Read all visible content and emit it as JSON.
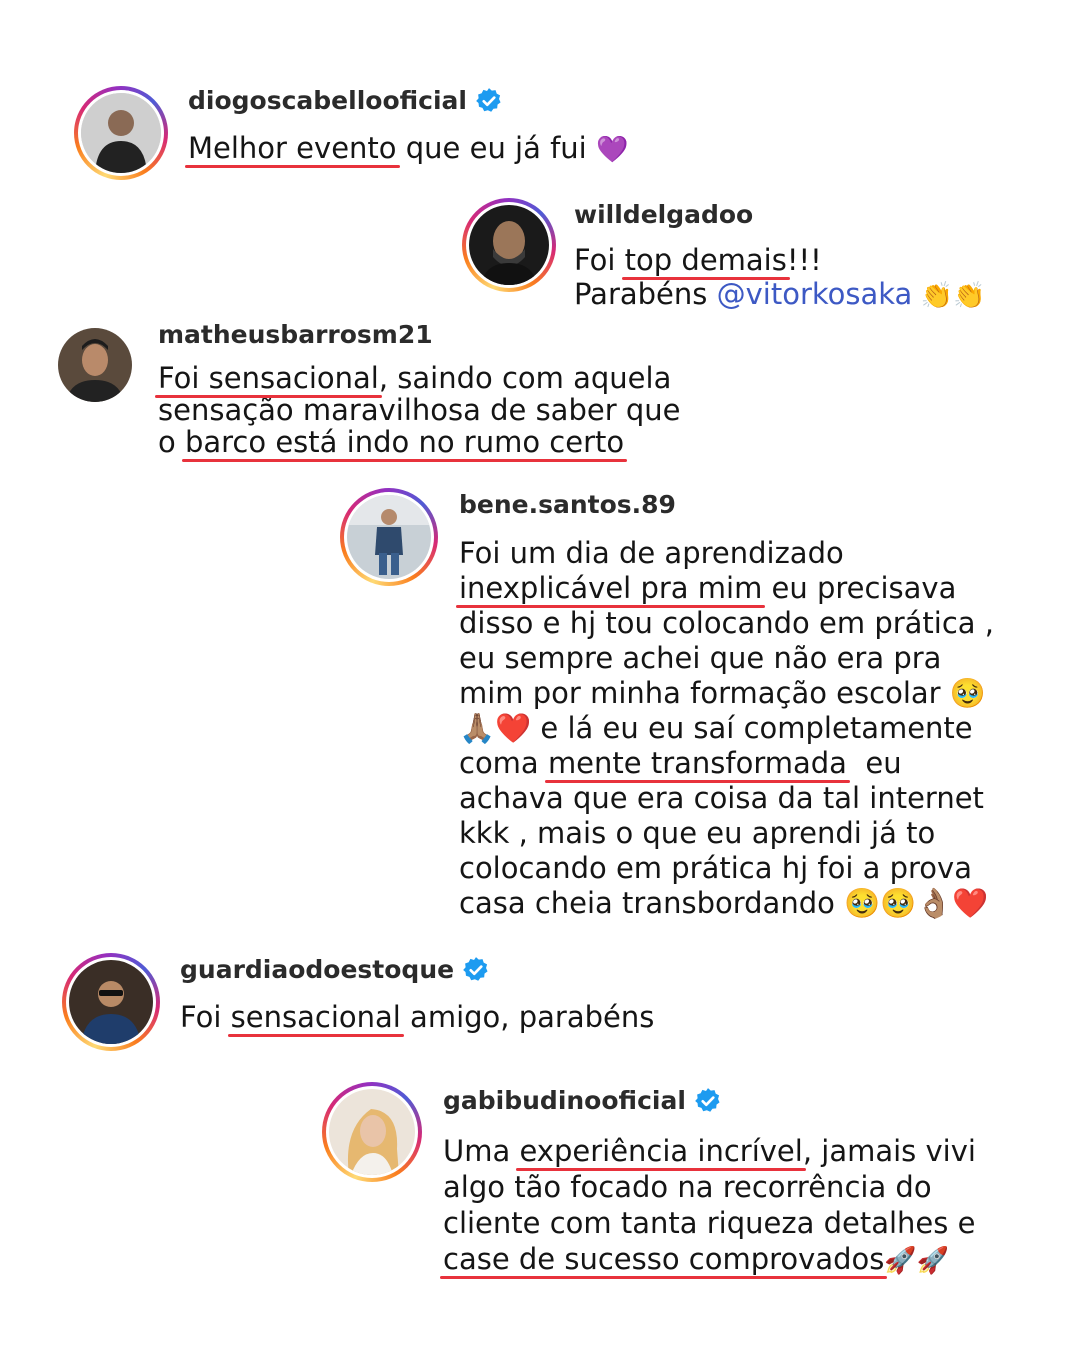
{
  "comments": [
    {
      "username": "diogoscabellooficial",
      "verified": true,
      "lines": [
        [
          "",
          "Melhor evento",
          " que eu já fui ",
          "💜"
        ]
      ]
    },
    {
      "username": "willdelgadoo",
      "verified": false,
      "line1": {
        "pre": "Foi ",
        "ul": "top demais",
        "post": "!!!"
      },
      "line2": {
        "pre": "Parabéns ",
        "mention": "@vitorkosaka",
        "emoji": " 👏👏"
      }
    },
    {
      "username": "matheusbarrosm21",
      "verified": false,
      "line1": {
        "ul": "Foi sensacional",
        "post": ", saindo com aquela"
      },
      "line2": "sensação maravilhosa de saber que",
      "line3": {
        "pre": "o ",
        "ul": "barco está indo no rumo certo"
      }
    },
    {
      "username": "bene.santos.89",
      "verified": false,
      "line1": "Foi um dia de aprendizado",
      "line2": {
        "ul": "inexplicável pra mim",
        "post": " eu precisava"
      },
      "line3": "disso e hj tou colocando em prática ,",
      "line4": "eu sempre achei que não era pra",
      "line5": "mim por minha formação escolar 🥹",
      "line6": "🙏🏽❤️ e lá eu eu saí completamente",
      "line7": {
        "pre": "coma ",
        "ul": "mente transformada",
        "post": "  eu"
      },
      "line8": "achava que era coisa da tal internet",
      "line9": "kkk , mais o que eu aprendi já to",
      "line10": "colocando em prática hj foi a prova",
      "line11": "casa cheia transbordando 🥹🥹👌🏽❤️"
    },
    {
      "username": "guardiaodoestoque",
      "verified": true,
      "line1": {
        "pre": "Foi ",
        "ul": "sensacional",
        "post": " amigo, parabéns"
      }
    },
    {
      "username": "gabibudinooficial",
      "verified": true,
      "line1": {
        "pre": "Uma ",
        "ul": "experiência incrível",
        "post": ", jamais vivi"
      },
      "line2": "algo tão focado na recorrência do",
      "line3": "cliente com tanta riqueza detalhes e",
      "line4": {
        "ul": "case de sucesso comprovados",
        "post": "🚀🚀"
      }
    }
  ],
  "colors": {
    "underline": "#e8323c",
    "mention": "#3d59c4",
    "verified": "#1d9bf0"
  },
  "icons": {
    "verified": "verified-badge-icon"
  }
}
